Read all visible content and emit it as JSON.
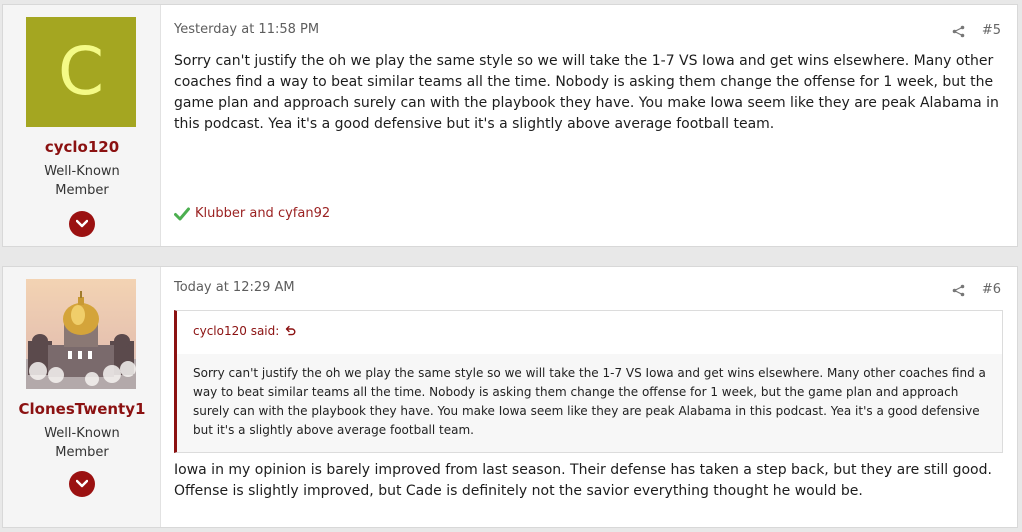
{
  "posts": [
    {
      "author": "cyclo120",
      "avatar_letter": "C",
      "avatar_color": "#a4a621",
      "user_title": "Well-Known Member",
      "timestamp": "Yesterday at 11:58 PM",
      "post_number": "#5",
      "body": "Sorry can't justify the oh we play the same style so we will take the 1-7 VS Iowa and get wins elsewhere. Many other coaches find a way to beat similar teams all the time. Nobody is asking them change the offense for 1 week, but the game plan and approach surely can with the playbook they have. You make Iowa seem like they are peak Alabama in this podcast. Yea it's a good defensive but it's a slightly above average football team.",
      "reactions": "Klubber and cyfan92"
    },
    {
      "author": "ClonesTwenty1",
      "user_title": "Well-Known Member",
      "timestamp": "Today at 12:29 AM",
      "post_number": "#6",
      "quote": {
        "attribution": "cyclo120 said:",
        "text": "Sorry can't justify the oh we play the same style so we will take the 1-7 VS Iowa and get wins elsewhere. Many other coaches find a way to beat similar teams all the time. Nobody is asking them change the offense for 1 week, but the game plan and approach surely can with the playbook they have. You make Iowa seem like they are peak Alabama in this podcast. Yea it's a good defensive but it's a slightly above average football team."
      },
      "body": "Iowa in my opinion is barely improved from last season. Their defense has taken a step back, but they are still good. Offense is slightly improved, but Cade is definitely not the savior everything thought he would be."
    }
  ],
  "colors": {
    "accent": "#8b1111",
    "reaction": "#9b2222"
  },
  "icons": {
    "share": "share-icon",
    "expand": "chevron-down-icon",
    "reaction": "checkmark-icon",
    "quote_jump": "return-arrow-icon"
  }
}
